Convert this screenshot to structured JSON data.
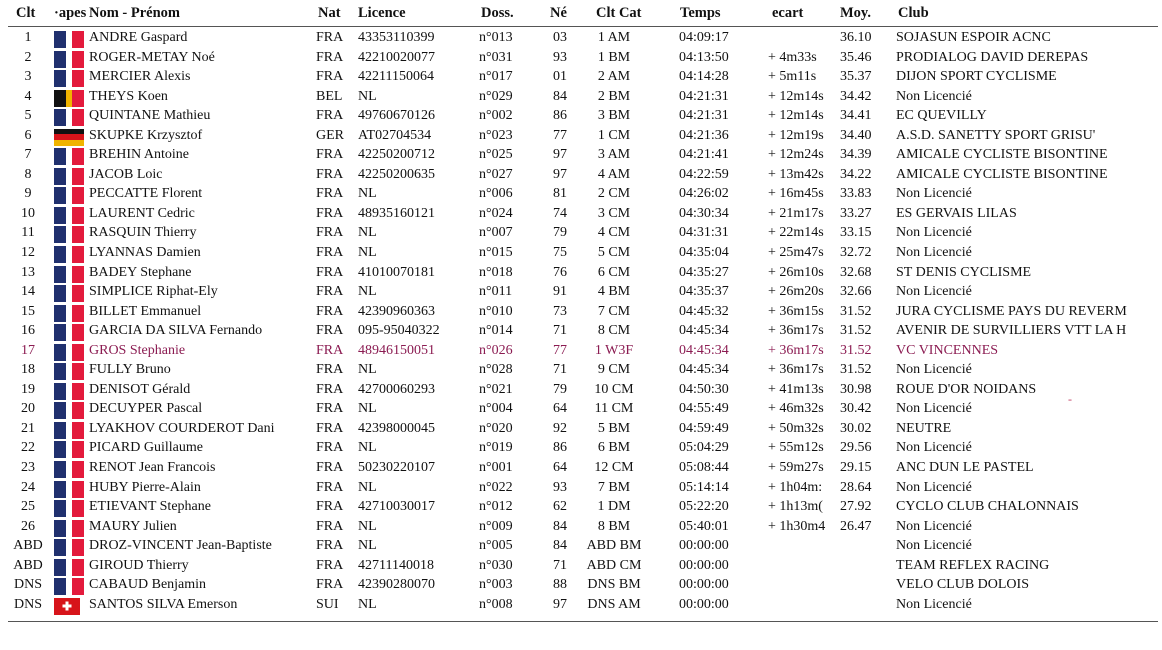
{
  "headers": {
    "clt": "Clt",
    "etapes": "·apes",
    "nom": "Nom - Prénom",
    "nat": "Nat",
    "licence": "Licence",
    "doss": "Doss.",
    "ne": "Né",
    "cltcat": "Clt Cat",
    "temps": "Temps",
    "ecart": "ecart",
    "moy": "Moy.",
    "club": "Club"
  },
  "flag_colors": {
    "fra": [
      "#20306e",
      "#ffffff",
      "#e31a3c"
    ],
    "bel": [
      "#111111",
      "#f0b400",
      "#e31a3c"
    ],
    "ger": [
      "#111111",
      "#d7141a",
      "#f0b400"
    ],
    "sui": [
      "#d7141a"
    ]
  },
  "highlight_color": "#8b1c52",
  "stray_mark": "-",
  "rows": [
    {
      "clt": "1",
      "nom": "ANDRE Gaspard",
      "nat": "FRA",
      "licence": "43353110399",
      "doss": "n°013",
      "ne": "03",
      "cat": "1 AM",
      "temps": "04:09:17",
      "ecart": "",
      "moy": "36.10",
      "club": "SOJASUN ESPOIR ACNC",
      "flag": "fra"
    },
    {
      "clt": "2",
      "nom": "ROGER-METAY Noé",
      "nat": "FRA",
      "licence": "42210020077",
      "doss": "n°031",
      "ne": "93",
      "cat": "1 BM",
      "temps": "04:13:50",
      "ecart": "+ 4m33s",
      "moy": "35.46",
      "club": "PRODIALOG DAVID DEREPAS",
      "flag": "fra"
    },
    {
      "clt": "3",
      "nom": "MERCIER Alexis",
      "nat": "FRA",
      "licence": "42211150064",
      "doss": "n°017",
      "ne": "01",
      "cat": "2 AM",
      "temps": "04:14:28",
      "ecart": "+ 5m11s",
      "moy": "35.37",
      "club": "DIJON SPORT CYCLISME",
      "flag": "fra"
    },
    {
      "clt": "4",
      "nom": "THEYS Koen",
      "nat": "BEL",
      "licence": "NL",
      "doss": "n°029",
      "ne": "84",
      "cat": "2 BM",
      "temps": "04:21:31",
      "ecart": "+ 12m14s",
      "moy": "34.42",
      "club": "Non Licencié",
      "flag": "bel"
    },
    {
      "clt": "5",
      "nom": "QUINTANE Mathieu",
      "nat": "FRA",
      "licence": "49760670126",
      "doss": "n°002",
      "ne": "86",
      "cat": "3 BM",
      "temps": "04:21:31",
      "ecart": "+ 12m14s",
      "moy": "34.41",
      "club": "EC QUEVILLY",
      "flag": "fra"
    },
    {
      "clt": "6",
      "nom": "SKUPKE Krzysztof",
      "nat": "GER",
      "licence": "AT02704534",
      "doss": "n°023",
      "ne": "77",
      "cat": "1 CM",
      "temps": "04:21:36",
      "ecart": "+ 12m19s",
      "moy": "34.40",
      "club": "A.S.D. SANETTY SPORT GRISU'",
      "flag": "ger"
    },
    {
      "clt": "7",
      "nom": "BREHIN Antoine",
      "nat": "FRA",
      "licence": "42250200712",
      "doss": "n°025",
      "ne": "97",
      "cat": "3 AM",
      "temps": "04:21:41",
      "ecart": "+ 12m24s",
      "moy": "34.39",
      "club": "AMICALE CYCLISTE BISONTINE",
      "flag": "fra"
    },
    {
      "clt": "8",
      "nom": "JACOB Loic",
      "nat": "FRA",
      "licence": "42250200635",
      "doss": "n°027",
      "ne": "97",
      "cat": "4 AM",
      "temps": "04:22:59",
      "ecart": "+ 13m42s",
      "moy": "34.22",
      "club": "AMICALE CYCLISTE BISONTINE",
      "flag": "fra"
    },
    {
      "clt": "9",
      "nom": "PECCATTE Florent",
      "nat": "FRA",
      "licence": "NL",
      "doss": "n°006",
      "ne": "81",
      "cat": "2 CM",
      "temps": "04:26:02",
      "ecart": "+ 16m45s",
      "moy": "33.83",
      "club": "Non Licencié",
      "flag": "fra"
    },
    {
      "clt": "10",
      "nom": "LAURENT Cedric",
      "nat": "FRA",
      "licence": "48935160121",
      "doss": "n°024",
      "ne": "74",
      "cat": "3 CM",
      "temps": "04:30:34",
      "ecart": "+ 21m17s",
      "moy": "33.27",
      "club": "ES GERVAIS LILAS",
      "flag": "fra"
    },
    {
      "clt": "11",
      "nom": "RASQUIN Thierry",
      "nat": "FRA",
      "licence": "NL",
      "doss": "n°007",
      "ne": "79",
      "cat": "4 CM",
      "temps": "04:31:31",
      "ecart": "+ 22m14s",
      "moy": "33.15",
      "club": "Non Licencié",
      "flag": "fra"
    },
    {
      "clt": "12",
      "nom": "LYANNAS Damien",
      "nat": "FRA",
      "licence": "NL",
      "doss": "n°015",
      "ne": "75",
      "cat": "5 CM",
      "temps": "04:35:04",
      "ecart": "+ 25m47s",
      "moy": "32.72",
      "club": "Non Licencié",
      "flag": "fra"
    },
    {
      "clt": "13",
      "nom": "BADEY Stephane",
      "nat": "FRA",
      "licence": "41010070181",
      "doss": "n°018",
      "ne": "76",
      "cat": "6 CM",
      "temps": "04:35:27",
      "ecart": "+ 26m10s",
      "moy": "32.68",
      "club": "ST DENIS CYCLISME",
      "flag": "fra"
    },
    {
      "clt": "14",
      "nom": "SIMPLICE Riphat-Ely",
      "nat": "FRA",
      "licence": "NL",
      "doss": "n°011",
      "ne": "91",
      "cat": "4 BM",
      "temps": "04:35:37",
      "ecart": "+ 26m20s",
      "moy": "32.66",
      "club": "Non Licencié",
      "flag": "fra"
    },
    {
      "clt": "15",
      "nom": "BILLET Emmanuel",
      "nat": "FRA",
      "licence": "42390960363",
      "doss": "n°010",
      "ne": "73",
      "cat": "7 CM",
      "temps": "04:45:32",
      "ecart": "+ 36m15s",
      "moy": "31.52",
      "club": "JURA CYCLISME PAYS DU REVERM",
      "flag": "fra"
    },
    {
      "clt": "16",
      "nom": "GARCIA DA SILVA Fernando",
      "nat": "FRA",
      "licence": "095-95040322",
      "doss": "n°014",
      "ne": "71",
      "cat": "8 CM",
      "temps": "04:45:34",
      "ecart": "+ 36m17s",
      "moy": "31.52",
      "club": "AVENIR DE SURVILLIERS VTT LA H",
      "flag": "fra"
    },
    {
      "clt": "17",
      "nom": "GROS Stephanie",
      "nat": "FRA",
      "licence": "48946150051",
      "doss": "n°026",
      "ne": "77",
      "cat": "1 W3F",
      "temps": "04:45:34",
      "ecart": "+ 36m17s",
      "moy": "31.52",
      "club": "VC VINCENNES",
      "flag": "fra",
      "highlight": true
    },
    {
      "clt": "18",
      "nom": "FULLY Bruno",
      "nat": "FRA",
      "licence": "NL",
      "doss": "n°028",
      "ne": "71",
      "cat": "9 CM",
      "temps": "04:45:34",
      "ecart": "+ 36m17s",
      "moy": "31.52",
      "club": "Non Licencié",
      "flag": "fra"
    },
    {
      "clt": "19",
      "nom": "DENISOT Gérald",
      "nat": "FRA",
      "licence": "42700060293",
      "doss": "n°021",
      "ne": "79",
      "cat": "10 CM",
      "temps": "04:50:30",
      "ecart": "+ 41m13s",
      "moy": "30.98",
      "club": "ROUE D'OR NOIDANS",
      "flag": "fra"
    },
    {
      "clt": "20",
      "nom": "DECUYPER Pascal",
      "nat": "FRA",
      "licence": "NL",
      "doss": "n°004",
      "ne": "64",
      "cat": "11 CM",
      "temps": "04:55:49",
      "ecart": "+ 46m32s",
      "moy": "30.42",
      "club": "Non Licencié",
      "flag": "fra"
    },
    {
      "clt": "21",
      "nom": "LYAKHOV COURDEROT Dani",
      "nat": "FRA",
      "licence": "42398000045",
      "doss": "n°020",
      "ne": "92",
      "cat": "5 BM",
      "temps": "04:59:49",
      "ecart": "+ 50m32s",
      "moy": "30.02",
      "club": "NEUTRE",
      "flag": "fra"
    },
    {
      "clt": "22",
      "nom": "PICARD Guillaume",
      "nat": "FRA",
      "licence": "NL",
      "doss": "n°019",
      "ne": "86",
      "cat": "6 BM",
      "temps": "05:04:29",
      "ecart": "+ 55m12s",
      "moy": "29.56",
      "club": "Non Licencié",
      "flag": "fra"
    },
    {
      "clt": "23",
      "nom": "RENOT Jean Francois",
      "nat": "FRA",
      "licence": "50230220107",
      "doss": "n°001",
      "ne": "64",
      "cat": "12 CM",
      "temps": "05:08:44",
      "ecart": "+ 59m27s",
      "moy": "29.15",
      "club": "ANC DUN LE PASTEL",
      "flag": "fra"
    },
    {
      "clt": "24",
      "nom": "HUBY Pierre-Alain",
      "nat": "FRA",
      "licence": "NL",
      "doss": "n°022",
      "ne": "93",
      "cat": "7 BM",
      "temps": "05:14:14",
      "ecart": "+ 1h04m:",
      "moy": "28.64",
      "club": "Non Licencié",
      "flag": "fra"
    },
    {
      "clt": "25",
      "nom": "ETIEVANT Stephane",
      "nat": "FRA",
      "licence": "42710030017",
      "doss": "n°012",
      "ne": "62",
      "cat": "1 DM",
      "temps": "05:22:20",
      "ecart": "+ 1h13m(",
      "moy": "27.92",
      "club": "CYCLO CLUB CHALONNAIS",
      "flag": "fra"
    },
    {
      "clt": "26",
      "nom": "MAURY Julien",
      "nat": "FRA",
      "licence": "NL",
      "doss": "n°009",
      "ne": "84",
      "cat": "8 BM",
      "temps": "05:40:01",
      "ecart": "+ 1h30m4",
      "moy": "26.47",
      "club": "Non Licencié",
      "flag": "fra"
    },
    {
      "clt": "ABD",
      "nom": "DROZ-VINCENT Jean-Baptiste",
      "nat": "FRA",
      "licence": "NL",
      "doss": "n°005",
      "ne": "84",
      "cat": "ABD BM",
      "temps": "00:00:00",
      "ecart": "",
      "moy": "",
      "club": "Non Licencié",
      "flag": "fra"
    },
    {
      "clt": "ABD",
      "nom": "GIROUD Thierry",
      "nat": "FRA",
      "licence": "42711140018",
      "doss": "n°030",
      "ne": "71",
      "cat": "ABD CM",
      "temps": "00:00:00",
      "ecart": "",
      "moy": "",
      "club": "TEAM REFLEX RACING",
      "flag": "fra"
    },
    {
      "clt": "DNS",
      "nom": "CABAUD Benjamin",
      "nat": "FRA",
      "licence": "42390280070",
      "doss": "n°003",
      "ne": "88",
      "cat": "DNS BM",
      "temps": "00:00:00",
      "ecart": "",
      "moy": "",
      "club": "VELO CLUB DOLOIS",
      "flag": "fra"
    },
    {
      "clt": "DNS",
      "nom": "SANTOS SILVA Emerson",
      "nat": "SUI",
      "licence": "NL",
      "doss": "n°008",
      "ne": "97",
      "cat": "DNS AM",
      "temps": "00:00:00",
      "ecart": "",
      "moy": "",
      "club": "Non Licencié",
      "flag": "sui"
    }
  ]
}
